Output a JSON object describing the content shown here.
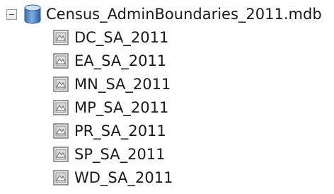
{
  "tree": {
    "root": {
      "label": "Census_AdminBoundaries_2011.mdb",
      "icon": "database-icon",
      "expanded": true
    },
    "children": [
      {
        "label": "DC_SA_2011",
        "icon": "feature-class-icon"
      },
      {
        "label": "EA_SA_2011",
        "icon": "feature-class-icon"
      },
      {
        "label": "MN_SA_2011",
        "icon": "feature-class-icon"
      },
      {
        "label": "MP_SA_2011",
        "icon": "feature-class-icon"
      },
      {
        "label": "PR_SA_2011",
        "icon": "feature-class-icon"
      },
      {
        "label": "SP_SA_2011",
        "icon": "feature-class-icon"
      },
      {
        "label": "WD_SA_2011",
        "icon": "feature-class-icon"
      }
    ]
  },
  "colors": {
    "db_body": "#5a8ec9",
    "db_top": "#b8d4ef",
    "fc_border": "#7a7a7a",
    "fc_fill": "#e8e8e8"
  }
}
